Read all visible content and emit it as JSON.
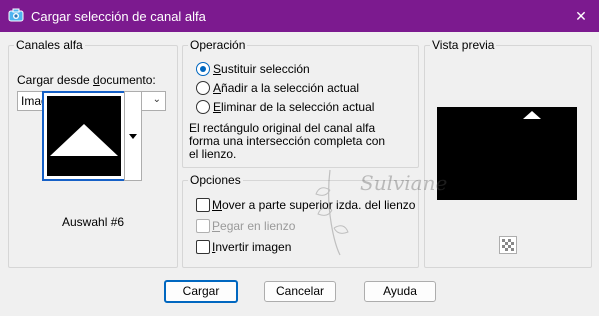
{
  "window": {
    "title": "Cargar selección de canal alfa",
    "close_label": "✕"
  },
  "alpha_channels": {
    "group_label": "Canales alfa",
    "load_from_label": "Cargar desde documento:",
    "document_value": "Imagen3",
    "selection_name": "Auswahl #6"
  },
  "operation": {
    "group_label": "Operación",
    "options": [
      {
        "label": "Sustituir selección",
        "selected": true
      },
      {
        "label": "Añadir a la selección actual",
        "selected": false
      },
      {
        "label": "Eliminar de la selección actual",
        "selected": false
      }
    ],
    "description": [
      "El rectángulo original del canal alfa",
      "forma una intersección completa con",
      "el lienzo."
    ]
  },
  "options": {
    "group_label": "Opciones",
    "items": [
      {
        "label": "Mover a parte superior izda. del lienzo",
        "checked": false,
        "enabled": true
      },
      {
        "label": "Pegar en lienzo",
        "checked": false,
        "enabled": false
      },
      {
        "label": "Invertir imagen",
        "checked": false,
        "enabled": true
      }
    ]
  },
  "preview": {
    "group_label": "Vista previa"
  },
  "watermark": {
    "text": "Sulviane"
  },
  "buttons": {
    "load": "Cargar",
    "cancel": "Cancelar",
    "help": "Ayuda"
  },
  "colors": {
    "titlebar": "#7c1a8f",
    "accent": "#0067c0"
  }
}
